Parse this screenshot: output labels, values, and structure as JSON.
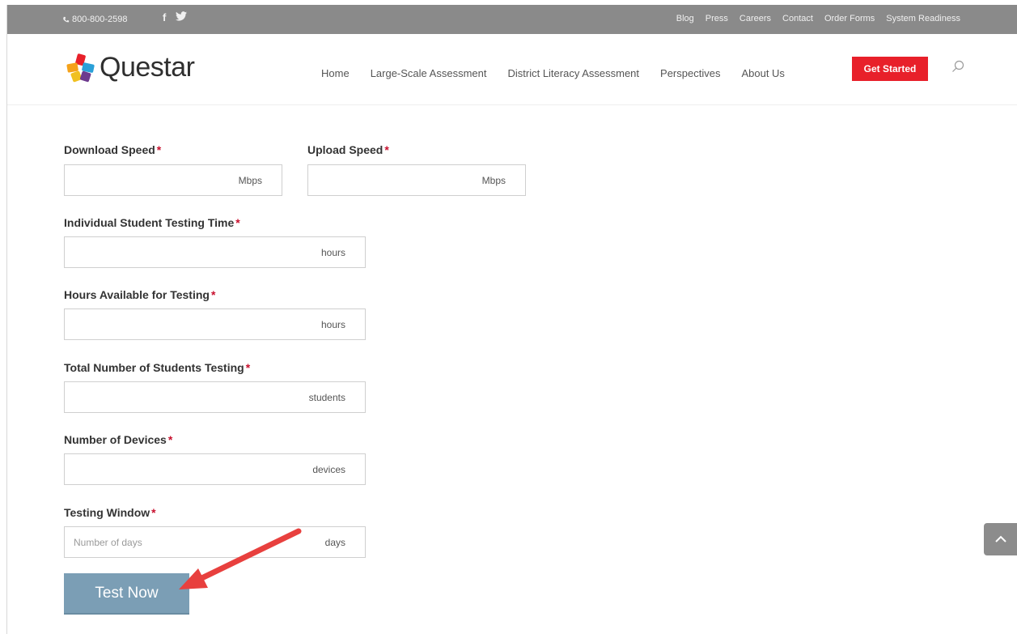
{
  "topbar": {
    "phone": "800-800-2598",
    "social": [
      {
        "icon": "facebook-icon",
        "glyph": "f"
      },
      {
        "icon": "twitter-icon",
        "glyph": "🐦"
      }
    ],
    "links": [
      "Blog",
      "Press",
      "Careers",
      "Contact",
      "Order Forms",
      "System Readiness"
    ]
  },
  "header": {
    "logo_text": "Questar",
    "nav": [
      "Home",
      "Large-Scale Assessment",
      "District Literacy Assessment",
      "Perspectives",
      "About Us"
    ],
    "cta": "Get Started"
  },
  "form": {
    "fields": [
      {
        "label": "Download Speed",
        "required": "*",
        "unit": "Mbps",
        "value": ""
      },
      {
        "label": "Upload Speed",
        "required": "*",
        "unit": "Mbps",
        "value": ""
      },
      {
        "label": "Individual Student Testing Time",
        "required": "*",
        "unit": "hours",
        "value": ""
      },
      {
        "label": "Hours Available for Testing",
        "required": "*",
        "unit": "hours",
        "value": ""
      },
      {
        "label": "Total Number of Students Testing",
        "required": "*",
        "unit": "students",
        "value": ""
      },
      {
        "label": "Number of Devices",
        "required": "*",
        "unit": "devices",
        "value": ""
      },
      {
        "label": "Testing Window",
        "required": "*",
        "unit": "days",
        "placeholder": "Number of days",
        "value": ""
      }
    ],
    "submit": "Test Now"
  },
  "colors": {
    "topbar_bg": "#8a8a8a",
    "cta_bg": "#e8202a",
    "required": "#c8102e",
    "button_bg": "#7b9eb5",
    "annotation_arrow": "#e8403e"
  }
}
